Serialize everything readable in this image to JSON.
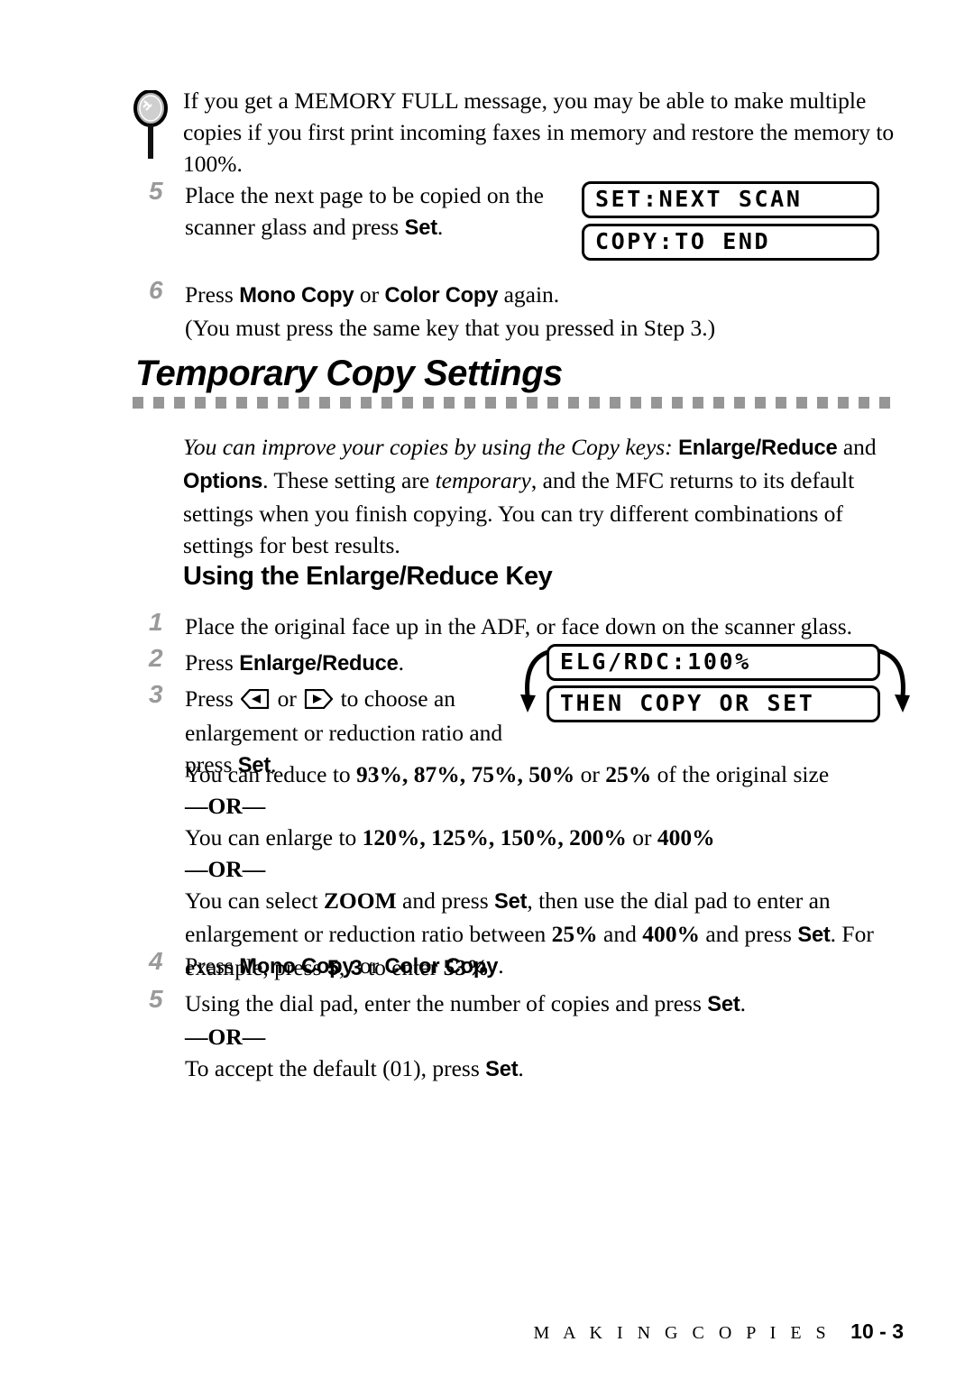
{
  "page": {
    "background": "#ffffff",
    "step_number_color": "#9a9a9a",
    "rule_color": "#969696"
  },
  "note": {
    "icon": "magnifier-icon",
    "line1_a": "If you get a ",
    "line1_b": "MEMORY FULL",
    "line1_c": " message, you may be able to make multiple copies if you first print incoming faxes in memory and restore the memory to 100%."
  },
  "steps_top": [
    {
      "number": "5",
      "text_a": "Place the next page to be copied on the scanner glass and press ",
      "key1": "Set",
      "text_b": "."
    },
    {
      "number": "6",
      "text_a": "Press ",
      "key1": "Mono Copy",
      "text_b": " or ",
      "key2": "Color Copy",
      "text_c": " again.",
      "line2": "(You must press the same key that you pressed in Step 3.)"
    }
  ],
  "lcd_top": {
    "line1": "SET:NEXT SCAN",
    "line2": "COPY:TO END"
  },
  "section": {
    "heading": "Temporary Copy Settings",
    "intro_a": "You can improve your copies by using the Copy keys:",
    "intro_key1": "Enlarge/Reduce",
    "intro_b": " and ",
    "intro_key2": "Options",
    "intro_c": ". These setting are ",
    "intro_em": "temporary",
    "intro_d": ", and the MFC returns to its default settings when you finish copying. You can try different combinations of settings for best results.",
    "sub_heading": "Using the Enlarge/Reduce Key"
  },
  "steps_main": [
    {
      "number": "1",
      "text": "Place the original face up in the ADF, or face down on the scanner glass."
    },
    {
      "number": "2",
      "text_a": "Press ",
      "key1": "Enlarge/Reduce",
      "text_b": "."
    },
    {
      "number": "3",
      "text_a": "Press ",
      "glyph_left": "left-arrow-key-icon",
      "text_b": " or ",
      "glyph_right": "right-arrow-key-icon",
      "text_c": " to choose an enlargement or reduction ratio and press ",
      "key1": "Set",
      "text_d": "."
    },
    {
      "number": "4",
      "text_a": "Press ",
      "key1": "Mono Copy",
      "text_b": " or ",
      "key2": "Color Copy",
      "text_c": "."
    },
    {
      "number": "5",
      "text_a": "Using the dial pad, enter the number of copies and press ",
      "key1": "Set",
      "text_b": ".",
      "or": "—OR—",
      "line2_a": "To accept the default (01), press ",
      "line2_key": "Set",
      "line2_b": "."
    }
  ],
  "ratio_info": {
    "reduce_a": "You can reduce to ",
    "reduce_values": "93%, 87%, 75%,  50%",
    "reduce_b": " or ",
    "reduce_last": "25%",
    "reduce_c": " of the original size",
    "or1": "—OR—",
    "enlarge_a": "You can enlarge to ",
    "enlarge_values": "120%, 125%, 150%, 200%",
    "enlarge_b": " or ",
    "enlarge_last": "400%",
    "or2": "—OR—",
    "zoom_a": "You can select ",
    "zoom_word": "ZOOM",
    "zoom_b": " and press ",
    "zoom_key1": "Set",
    "zoom_c": ", then use the dial pad to enter an enlargement or reduction ratio between ",
    "zoom_min": "25%",
    "zoom_d": " and ",
    "zoom_max": "400%",
    "zoom_e": " and press ",
    "zoom_key2": "Set",
    "zoom_f": ". For example, press ",
    "zoom_digit1": "5",
    "zoom_g": ", ",
    "zoom_digit2": "3",
    "zoom_h": " to enter ",
    "zoom_result": "53%",
    "zoom_i": "."
  },
  "lcd_main": {
    "line1": "ELG/RDC:100%",
    "line2": "THEN COPY OR SET"
  },
  "footer": {
    "title": "M A K I N G   C O P I E S",
    "page": "10 - 3"
  }
}
